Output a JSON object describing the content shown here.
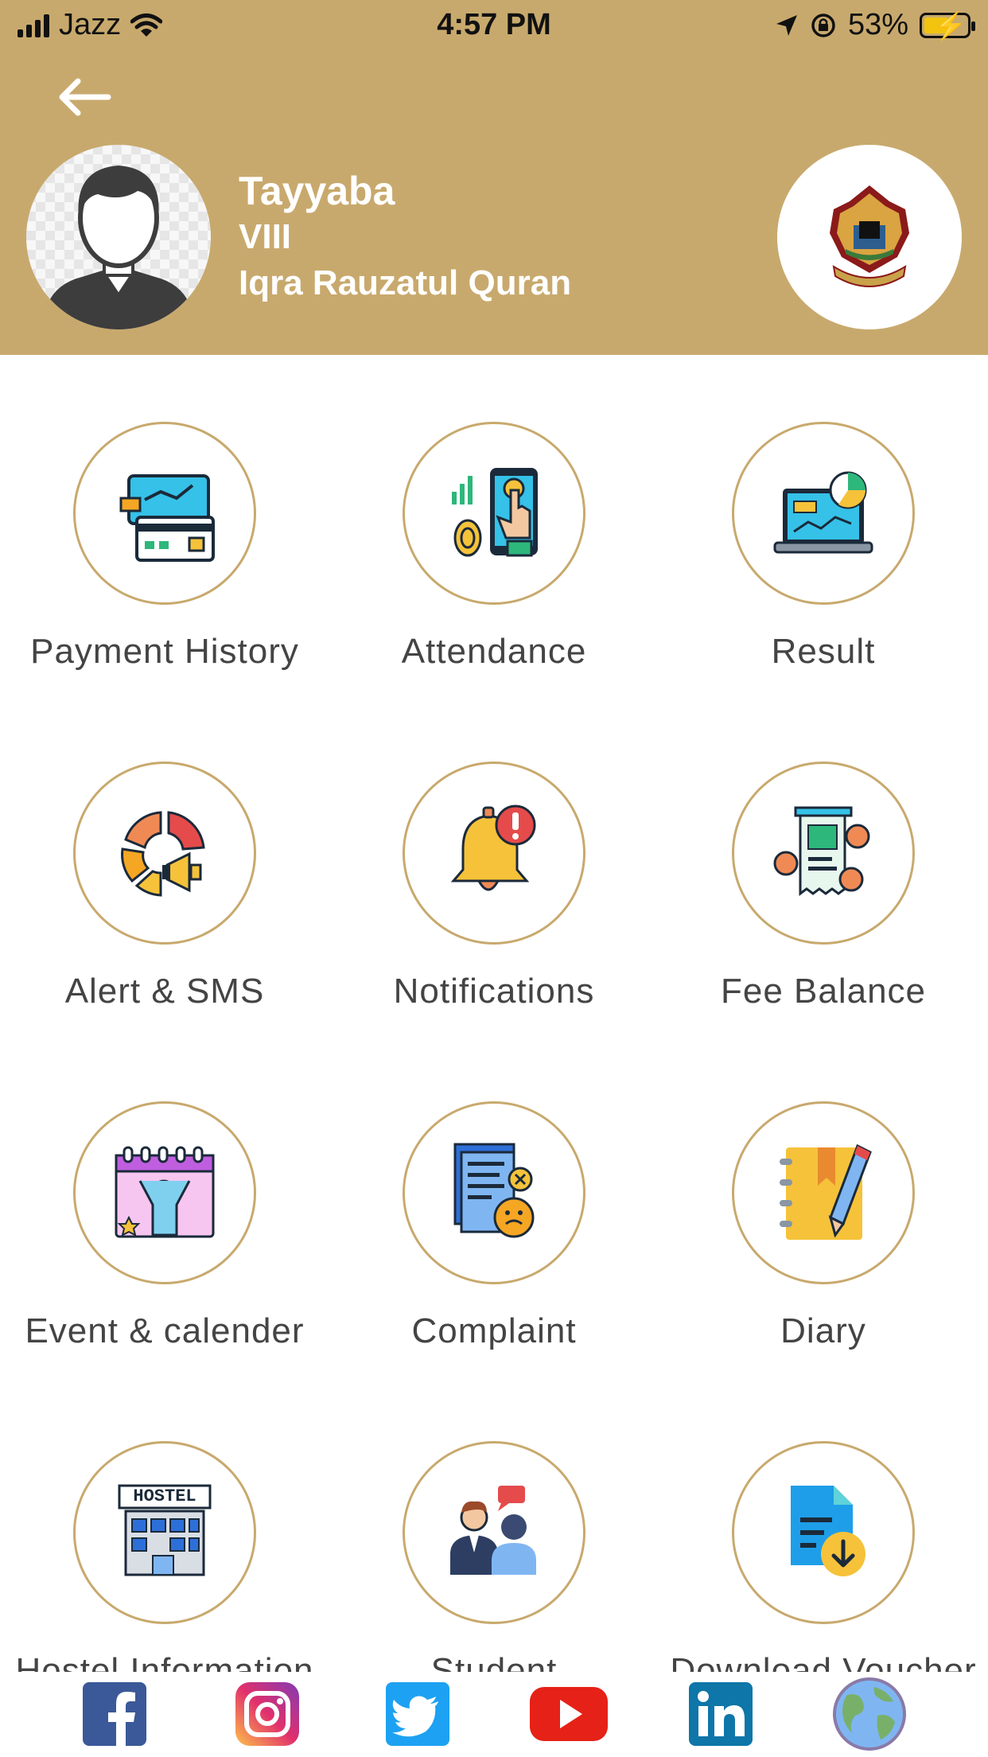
{
  "status_bar": {
    "carrier": "Jazz",
    "time": "4:57 PM",
    "battery": "53%"
  },
  "profile": {
    "name": "Tayyaba",
    "class": "VIII",
    "school": "Iqra Rauzatul Quran"
  },
  "menu": [
    {
      "label": "Payment History",
      "icon": "payment-history-icon"
    },
    {
      "label": "Attendance",
      "icon": "attendance-icon"
    },
    {
      "label": "Result",
      "icon": "result-icon"
    },
    {
      "label": "Alert & SMS",
      "icon": "alert-sms-icon"
    },
    {
      "label": "Notifications",
      "icon": "notifications-icon"
    },
    {
      "label": "Fee Balance",
      "icon": "fee-balance-icon"
    },
    {
      "label": "Event & calender",
      "icon": "event-calendar-icon"
    },
    {
      "label": "Complaint",
      "icon": "complaint-icon"
    },
    {
      "label": "Diary",
      "icon": "diary-icon"
    },
    {
      "label": "Hostel Information",
      "icon": "hostel-icon"
    },
    {
      "label": "Student Consultancy",
      "icon": "consultancy-icon"
    },
    {
      "label": "Download Voucher",
      "icon": "download-voucher-icon"
    }
  ],
  "social": [
    "facebook-icon",
    "instagram-icon",
    "twitter-icon",
    "youtube-icon",
    "linkedin-icon",
    "website-globe-icon"
  ],
  "colors": {
    "header": "#c8a96d",
    "circle_border": "#c8a96d",
    "label": "#444444"
  }
}
